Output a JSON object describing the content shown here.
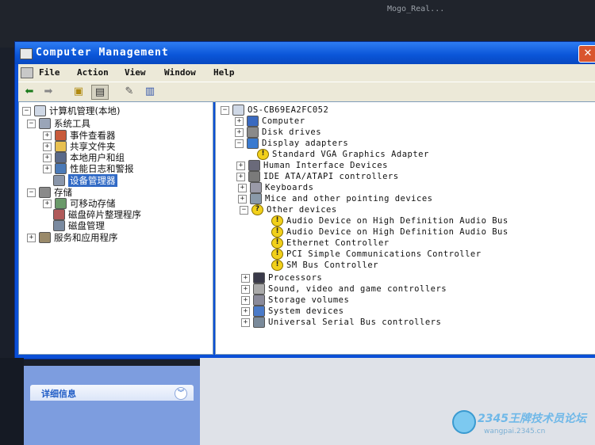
{
  "background_window_title": "Mogo_Real...",
  "window": {
    "title": "Computer Management",
    "icon": "computer-management-icon"
  },
  "menu": [
    "File",
    "Action",
    "View",
    "Window",
    "Help"
  ],
  "toolbar": {
    "buttons": [
      "back-arrow-icon",
      "forward-arrow-icon",
      "up-folder-icon",
      "show-hide-tree-icon",
      "properties-icon",
      "help-icon"
    ]
  },
  "left_tree": {
    "root": "计算机管理(本地)",
    "system_tools": "系统工具",
    "event_viewer": "事件查看器",
    "shared_folders": "共享文件夹",
    "local_users": "本地用户和组",
    "perf_logs": "性能日志和警报",
    "device_manager": "设备管理器",
    "storage": "存储",
    "removable_storage": "可移动存储",
    "defrag": "磁盘碎片整理程序",
    "disk_mgmt": "磁盘管理",
    "services": "服务和应用程序"
  },
  "device_tree": {
    "root": "OS-CB69EA2FC052",
    "computer": "Computer",
    "disk_drives": "Disk drives",
    "display_adapters": "Display adapters",
    "vga": "Standard VGA Graphics Adapter",
    "hid": "Human Interface Devices",
    "ide": "IDE ATA/ATAPI controllers",
    "keyboards": "Keyboards",
    "mice": "Mice and other pointing devices",
    "other_devices": "Other devices",
    "audio1": "Audio Device on High Definition Audio Bus",
    "audio2": "Audio Device on High Definition Audio Bus",
    "ethernet": "Ethernet Controller",
    "pci": "PCI Simple Communications Controller",
    "smbus": "SM Bus Controller",
    "processors": "Processors",
    "sound": "Sound, video and game controllers",
    "storage_volumes": "Storage volumes",
    "system_devices": "System devices",
    "usb": "Universal Serial Bus controllers"
  },
  "side_panel": {
    "details_label": "详细信息"
  },
  "watermark": {
    "title": "2345王牌技术员论坛",
    "url": "wangpai.2345.cn"
  }
}
